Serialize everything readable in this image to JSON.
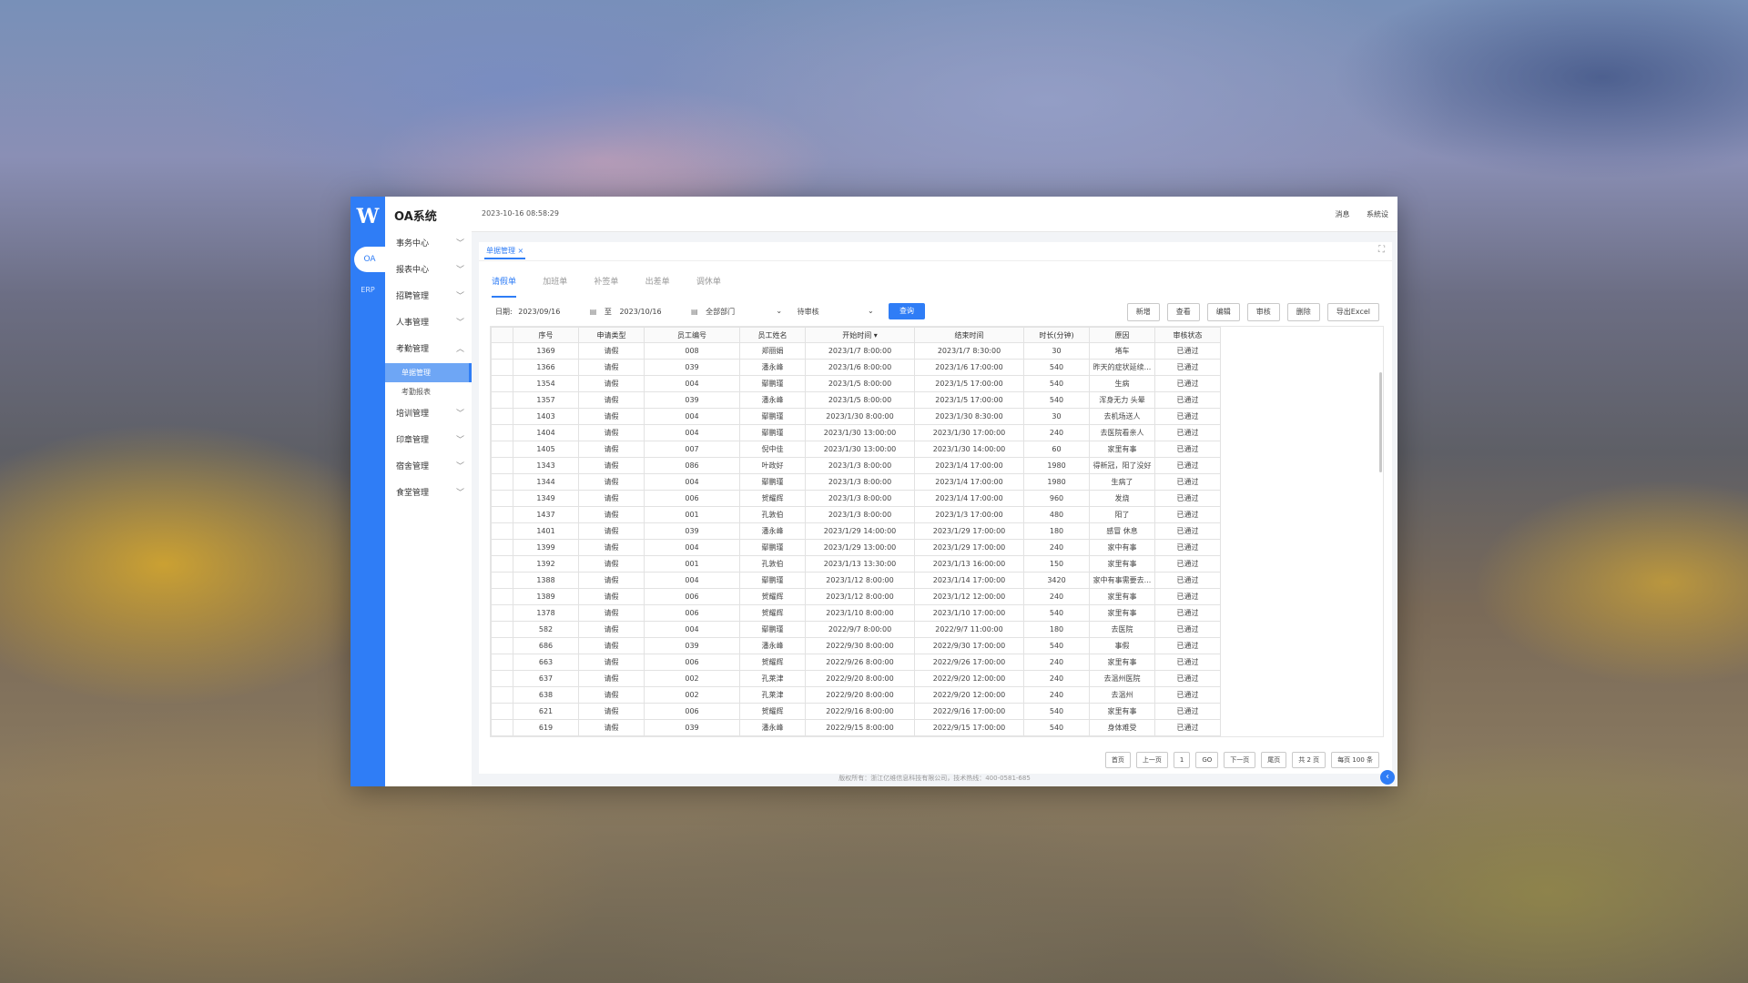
{
  "app": {
    "logo_letter": "W",
    "title": "OA系统",
    "datetime": "2023-10-16 08:58:29",
    "top_right": [
      "消息",
      "系統设"
    ]
  },
  "rail": {
    "oa_label": "OA",
    "erp_label": "ERP"
  },
  "sidebar": {
    "menus": [
      {
        "label": "事务中心",
        "chev": "﹀"
      },
      {
        "label": "报表中心",
        "chev": "﹀"
      },
      {
        "label": "招聘管理",
        "chev": "﹀"
      },
      {
        "label": "人事管理",
        "chev": "﹀"
      },
      {
        "label": "考勤管理",
        "chev": "︿"
      },
      {
        "label": "培训管理",
        "chev": "﹀"
      },
      {
        "label": "印章管理",
        "chev": "﹀"
      },
      {
        "label": "宿舍管理",
        "chev": "﹀"
      },
      {
        "label": "食堂管理",
        "chev": "﹀"
      }
    ],
    "submenus": [
      {
        "label": "单据管理",
        "active": true
      },
      {
        "label": "考勤报表",
        "active": false
      }
    ]
  },
  "main": {
    "page_tab": "单据管理 ×",
    "subtabs": [
      "请假单",
      "加班单",
      "补签单",
      "出差单",
      "调休单"
    ],
    "filter": {
      "date_label": "日期:",
      "start": "2023/09/16",
      "to": "至",
      "end": "2023/10/16",
      "calendar_icon": "▤",
      "dept": "全部部门",
      "status": "待审核",
      "arrow": "⌄",
      "query": "查询"
    },
    "actions": [
      "新增",
      "查看",
      "编辑",
      "审核",
      "删除",
      "导出Excel"
    ],
    "headers": [
      "",
      "序号",
      "申请类型",
      "员工编号",
      "员工姓名",
      "开始时间 ▾",
      "结束时间",
      "时长(分钟)",
      "原因",
      "审核状态"
    ],
    "rows": [
      [
        "1369",
        "请假",
        "008",
        "郑丽娟",
        "2023/1/7 8:00:00",
        "2023/1/7 8:30:00",
        "30",
        "堵车",
        "已通过"
      ],
      [
        "1366",
        "请假",
        "039",
        "潘永峰",
        "2023/1/6 8:00:00",
        "2023/1/6 17:00:00",
        "540",
        "昨天的症状延续...",
        "已通过"
      ],
      [
        "1354",
        "请假",
        "004",
        "鄢鹏瑾",
        "2023/1/5 8:00:00",
        "2023/1/5 17:00:00",
        "540",
        "生病",
        "已通过"
      ],
      [
        "1357",
        "请假",
        "039",
        "潘永峰",
        "2023/1/5 8:00:00",
        "2023/1/5 17:00:00",
        "540",
        "浑身无力 头晕",
        "已通过"
      ],
      [
        "1403",
        "请假",
        "004",
        "鄢鹏瑾",
        "2023/1/30 8:00:00",
        "2023/1/30 8:30:00",
        "30",
        "去机场送人",
        "已通过"
      ],
      [
        "1404",
        "请假",
        "004",
        "鄢鹏瑾",
        "2023/1/30 13:00:00",
        "2023/1/30 17:00:00",
        "240",
        "去医院看亲人",
        "已通过"
      ],
      [
        "1405",
        "请假",
        "007",
        "倪中佳",
        "2023/1/30 13:00:00",
        "2023/1/30 14:00:00",
        "60",
        "家里有事",
        "已通过"
      ],
      [
        "1343",
        "请假",
        "086",
        "叶政好",
        "2023/1/3 8:00:00",
        "2023/1/4 17:00:00",
        "1980",
        "得新冠，阳了没好",
        "已通过"
      ],
      [
        "1344",
        "请假",
        "004",
        "鄢鹏瑾",
        "2023/1/3 8:00:00",
        "2023/1/4 17:00:00",
        "1980",
        "生病了",
        "已通过"
      ],
      [
        "1349",
        "请假",
        "006",
        "贺耀辉",
        "2023/1/3 8:00:00",
        "2023/1/4 17:00:00",
        "960",
        "发烧",
        "已通过"
      ],
      [
        "1437",
        "请假",
        "001",
        "孔敦伯",
        "2023/1/3 8:00:00",
        "2023/1/3 17:00:00",
        "480",
        "阳了",
        "已通过"
      ],
      [
        "1401",
        "请假",
        "039",
        "潘永峰",
        "2023/1/29 14:00:00",
        "2023/1/29 17:00:00",
        "180",
        "感冒 休息",
        "已通过"
      ],
      [
        "1399",
        "请假",
        "004",
        "鄢鹏瑾",
        "2023/1/29 13:00:00",
        "2023/1/29 17:00:00",
        "240",
        "家中有事",
        "已通过"
      ],
      [
        "1392",
        "请假",
        "001",
        "孔敦伯",
        "2023/1/13 13:30:00",
        "2023/1/13 16:00:00",
        "150",
        "家里有事",
        "已通过"
      ],
      [
        "1388",
        "请假",
        "004",
        "鄢鹏瑾",
        "2023/1/12 8:00:00",
        "2023/1/14 17:00:00",
        "3420",
        "家中有事需要去...",
        "已通过"
      ],
      [
        "1389",
        "请假",
        "006",
        "贺耀辉",
        "2023/1/12 8:00:00",
        "2023/1/12 12:00:00",
        "240",
        "家里有事",
        "已通过"
      ],
      [
        "1378",
        "请假",
        "006",
        "贺耀辉",
        "2023/1/10 8:00:00",
        "2023/1/10 17:00:00",
        "540",
        "家里有事",
        "已通过"
      ],
      [
        "582",
        "请假",
        "004",
        "鄢鹏瑾",
        "2022/9/7 8:00:00",
        "2022/9/7 11:00:00",
        "180",
        "去医院",
        "已通过"
      ],
      [
        "686",
        "请假",
        "039",
        "潘永峰",
        "2022/9/30 8:00:00",
        "2022/9/30 17:00:00",
        "540",
        "事假",
        "已通过"
      ],
      [
        "663",
        "请假",
        "006",
        "贺耀辉",
        "2022/9/26 8:00:00",
        "2022/9/26 17:00:00",
        "240",
        "家里有事",
        "已通过"
      ],
      [
        "637",
        "请假",
        "002",
        "孔莱津",
        "2022/9/20 8:00:00",
        "2022/9/20 12:00:00",
        "240",
        "去温州医院",
        "已通过"
      ],
      [
        "638",
        "请假",
        "002",
        "孔莱津",
        "2022/9/20 8:00:00",
        "2022/9/20 12:00:00",
        "240",
        "去温州",
        "已通过"
      ],
      [
        "621",
        "请假",
        "006",
        "贺耀辉",
        "2022/9/16 8:00:00",
        "2022/9/16 17:00:00",
        "540",
        "家里有事",
        "已通过"
      ],
      [
        "619",
        "请假",
        "039",
        "潘永峰",
        "2022/9/15 8:00:00",
        "2022/9/15 17:00:00",
        "540",
        "身体难受",
        "已通过"
      ]
    ],
    "pager": [
      "首页",
      "上一页",
      "1",
      "GO",
      "下一页",
      "尾页",
      "共 2 页",
      "每页 100 条"
    ]
  },
  "footer": "版权所有：浙江亿维信息科技有限公司，技术热线：400-0581-685",
  "colors": {
    "accent": "#2f7df6"
  }
}
